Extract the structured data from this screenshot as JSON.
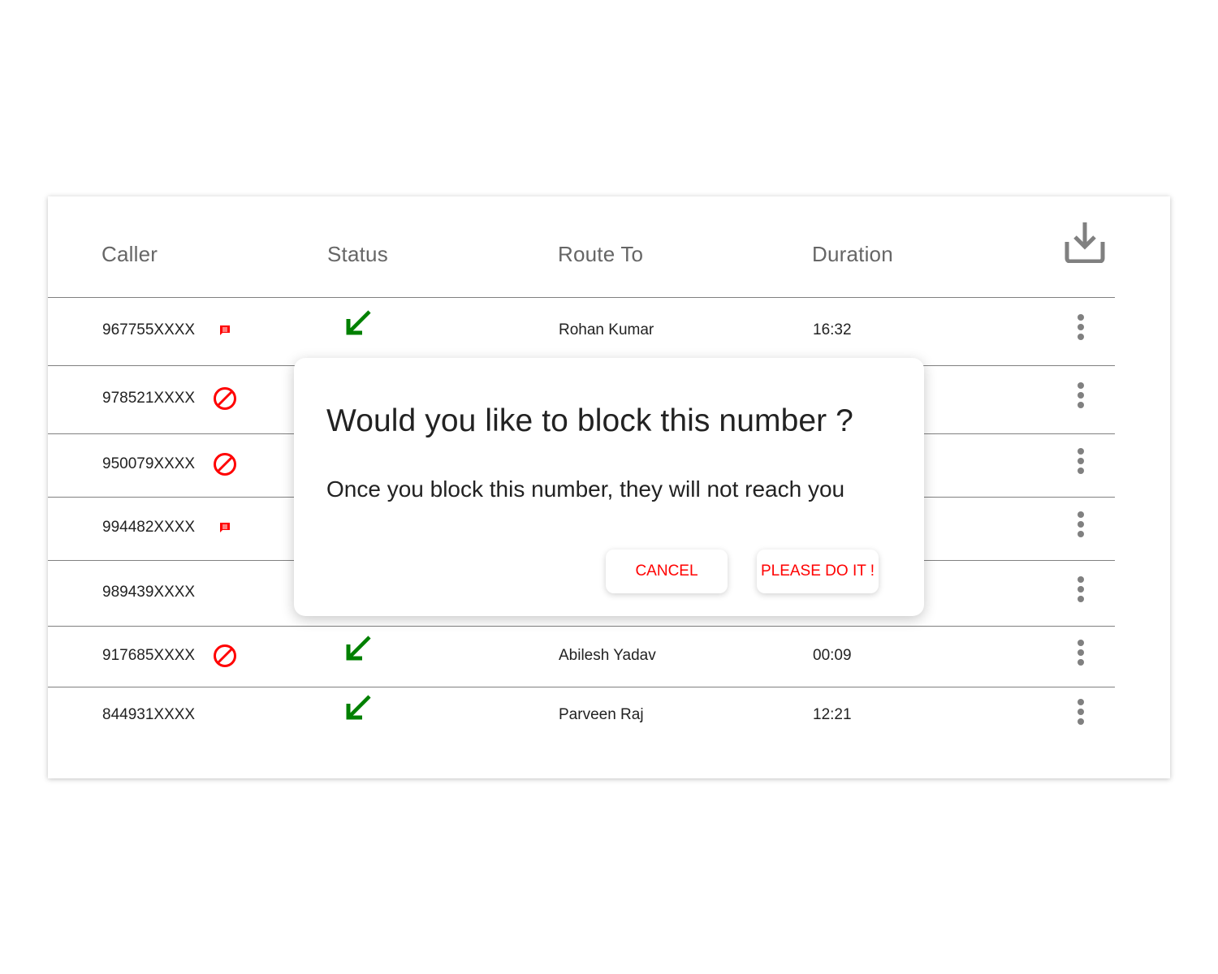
{
  "table": {
    "columns": {
      "caller": "Caller",
      "status": "Status",
      "route_to": "Route To",
      "duration": "Duration"
    },
    "download_icon": "download-icon",
    "rows": [
      {
        "caller": "967755XXXX",
        "caller_icon": "message-icon",
        "status_icon": "incoming-call-arrow-icon",
        "route_to": "Rohan Kumar",
        "duration": "16:32"
      },
      {
        "caller": "978521XXXX",
        "caller_icon": "blocked-icon",
        "status_icon": "",
        "route_to": "",
        "duration": ""
      },
      {
        "caller": "950079XXXX",
        "caller_icon": "blocked-icon",
        "status_icon": "",
        "route_to": "",
        "duration": ""
      },
      {
        "caller": "994482XXXX",
        "caller_icon": "message-icon",
        "status_icon": "",
        "route_to": "",
        "duration": ""
      },
      {
        "caller": "989439XXXX",
        "caller_icon": "",
        "status_icon": "",
        "route_to": "",
        "duration": ""
      },
      {
        "caller": "917685XXXX",
        "caller_icon": "blocked-icon",
        "status_icon": "incoming-call-arrow-icon",
        "route_to": "Abilesh Yadav",
        "duration": "00:09"
      },
      {
        "caller": "844931XXXX",
        "caller_icon": "",
        "status_icon": "incoming-call-arrow-icon",
        "route_to": "Parveen Raj",
        "duration": "12:21"
      }
    ]
  },
  "dialog": {
    "title": "Would you like to block this number ?",
    "body": "Once you block this number, they will not reach you",
    "cancel_label": "CANCEL",
    "confirm_label": "PLEASE DO IT !"
  },
  "colors": {
    "accent_red": "#ff0000",
    "incoming_green": "#008000",
    "header_gray": "#666666",
    "icon_gray": "#808080"
  }
}
